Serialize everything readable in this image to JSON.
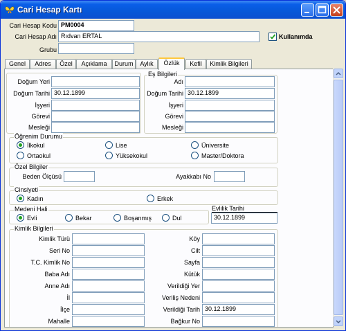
{
  "window": {
    "title": "Cari Hesap Kartı"
  },
  "header": {
    "code_label": "Cari Hesap Kodu",
    "code_value": "PM0004",
    "name_label": "Cari Hesap Adı",
    "name_value": "Rıdvan ERTAL",
    "group_label": "Grubu",
    "group_value": "",
    "active_label": "Kullanımda",
    "active_checked": true
  },
  "tabs": [
    "Genel",
    "Adres",
    "Özel",
    "Açıklama",
    "Durum",
    "Aylık",
    "Özlük",
    "Kefil",
    "Kimlik Bilgileri"
  ],
  "active_tab": "Özlük",
  "personal": {
    "birthplace_label": "Doğum Yeri",
    "birthplace_value": "",
    "birthdate_label": "Doğum Tarihi",
    "birthdate_value": "30.12.1899",
    "workplace_label": "İşyeri",
    "workplace_value": "",
    "duty_label": "Görevi",
    "duty_value": "",
    "job_label": "Mesleği",
    "job_value": ""
  },
  "spouse": {
    "title": "Eş Bilgileri",
    "name_label": "Adı",
    "name_value": "",
    "birthdate_label": "Doğum Tarihi",
    "birthdate_value": "30.12.1899",
    "workplace_label": "İşyeri",
    "workplace_value": "",
    "duty_label": "Görevi",
    "duty_value": "",
    "job_label": "Mesleği",
    "job_value": ""
  },
  "education": {
    "title": "Öğrenim Durumu",
    "options": [
      "İlkokul",
      "Lise",
      "Üniversite",
      "Ortaokul",
      "Yüksekokul",
      "Master/Doktora"
    ],
    "selected": "İlkokul"
  },
  "special": {
    "title": "Özel Bilgiler",
    "body_label": "Beden  Ölçüsü",
    "body_value": "",
    "shoe_label": "Ayakkabı No",
    "shoe_value": ""
  },
  "gender": {
    "title": "Cinsiyeti",
    "options": [
      "Kadın",
      "Erkek"
    ],
    "selected": "Kadın"
  },
  "marital": {
    "title": "Medeni Hali",
    "options": [
      "Evli",
      "Bekar",
      "Boşanmış",
      "Dul"
    ],
    "selected": "Evli"
  },
  "marriage": {
    "label": "Evlilik Tarihi",
    "value": "30.12.1899"
  },
  "identity": {
    "title": "Kimlik Bilgileri",
    "left": [
      {
        "label": "Kimlik Türü",
        "value": ""
      },
      {
        "label": "Seri No",
        "value": ""
      },
      {
        "label": "T.C. Kimlik No",
        "value": ""
      },
      {
        "label": "Baba Adı",
        "value": ""
      },
      {
        "label": "Anne Adı",
        "value": ""
      },
      {
        "label": "İl",
        "value": ""
      },
      {
        "label": "İlçe",
        "value": ""
      },
      {
        "label": "Mahalle",
        "value": ""
      }
    ],
    "right": [
      {
        "label": "Köy",
        "value": ""
      },
      {
        "label": "Cilt",
        "value": ""
      },
      {
        "label": "Sayfa",
        "value": ""
      },
      {
        "label": "Kütük",
        "value": ""
      },
      {
        "label": "Verildiği Yer",
        "value": ""
      },
      {
        "label": "Veriliş Nedeni",
        "value": ""
      },
      {
        "label": "Verildiği Tarih",
        "value": "30.12.1899"
      },
      {
        "label": "Bağkur No",
        "value": ""
      }
    ]
  },
  "colors": {
    "titlebar": "#0a5ee8",
    "window_bg": "#ece9d8",
    "panel_bg": "#fcfcfe",
    "active_tab_accent": "#ffc83c",
    "radio_dot": "#21a121"
  }
}
